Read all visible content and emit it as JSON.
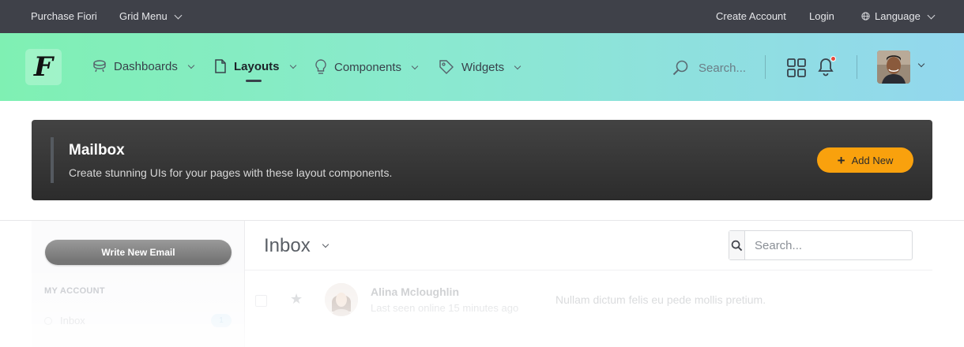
{
  "topbar": {
    "brand": "Purchase Fiori",
    "grid_menu": "Grid Menu",
    "create_account": "Create Account",
    "login": "Login",
    "language": "Language"
  },
  "header": {
    "logo_letter": "F",
    "nav": [
      {
        "label": "Dashboards",
        "icon": "dashboard-icon",
        "active": false
      },
      {
        "label": "Layouts",
        "icon": "document-icon",
        "active": true
      },
      {
        "label": "Components",
        "icon": "bulb-icon",
        "active": false
      },
      {
        "label": "Widgets",
        "icon": "tag-icon",
        "active": false
      }
    ],
    "search_placeholder": "Search...",
    "notification_dot_color": "#e64a3c"
  },
  "banner": {
    "title": "Mailbox",
    "subtitle": "Create stunning UIs for your pages with these layout components.",
    "add_button": "Add New",
    "accent_color": "#f9a10d"
  },
  "sidebar": {
    "write_button": "Write New Email",
    "section_heading": "MY ACCOUNT",
    "items": [
      {
        "label": "Inbox",
        "count": "1"
      }
    ]
  },
  "main": {
    "title": "Inbox",
    "search_placeholder": "Search...",
    "emails": [
      {
        "name": "Alina Mcloughlin",
        "status": "Last seen online 15 minutes ago",
        "preview": "Nullam dictum felis eu pede mollis pretium."
      }
    ]
  }
}
